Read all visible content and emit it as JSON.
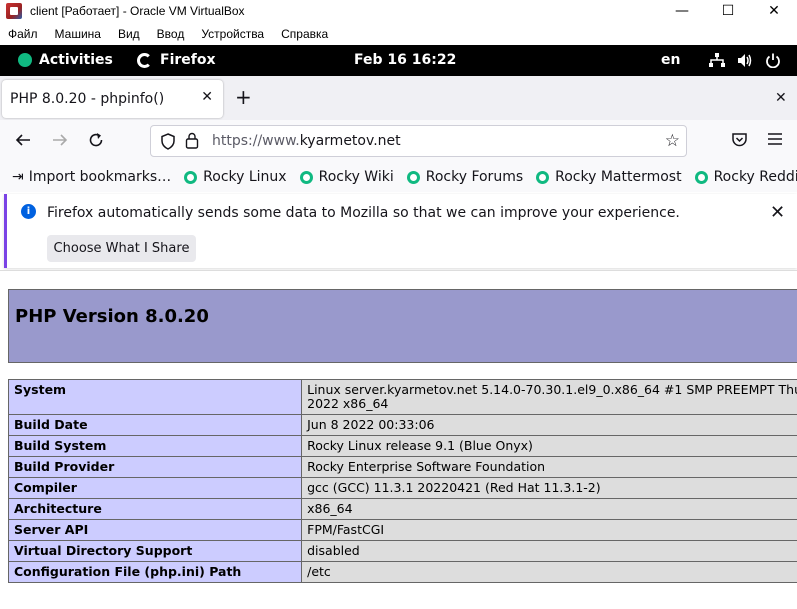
{
  "window": {
    "title": "client [Работает] - Oracle VM VirtualBox",
    "controls": {
      "minimize": "—",
      "maximize": "☐",
      "close": "✕"
    }
  },
  "vbox_menu": [
    "Файл",
    "Машина",
    "Вид",
    "Ввод",
    "Устройства",
    "Справка"
  ],
  "gnome": {
    "activities": "Activities",
    "app": "Firefox",
    "clock": "Feb 16  16:22",
    "lang": "en",
    "icons": [
      "network-icon",
      "volume-icon",
      "power-icon"
    ]
  },
  "browser": {
    "tab_title": "PHP 8.0.20 - phpinfo()",
    "url_prefix": "https://www.",
    "url_host": "kyarmetov.net",
    "bookmarks": [
      {
        "label": "Import bookmarks…",
        "icon": "import-icon"
      },
      {
        "label": "Rocky Linux",
        "icon": "rocky-icon"
      },
      {
        "label": "Rocky Wiki",
        "icon": "rocky-icon"
      },
      {
        "label": "Rocky Forums",
        "icon": "rocky-icon"
      },
      {
        "label": "Rocky Mattermost",
        "icon": "rocky-icon"
      },
      {
        "label": "Rocky Reddit",
        "icon": "rocky-icon"
      }
    ],
    "notification": {
      "message": "Firefox automatically sends some data to Mozilla so that we can improve your experience.",
      "button": "Choose What I Share"
    }
  },
  "php": {
    "header": "PHP Version 8.0.20",
    "rows": [
      {
        "key": "System",
        "value": "Linux server.kyarmetov.net 5.14.0-70.30.1.el9_0.x86_64 #1 SMP PREEMPT Thu",
        "value2": "2022 x86_64"
      },
      {
        "key": "Build Date",
        "value": "Jun 8 2022 00:33:06"
      },
      {
        "key": "Build System",
        "value": "Rocky Linux release 9.1 (Blue Onyx)"
      },
      {
        "key": "Build Provider",
        "value": "Rocky Enterprise Software Foundation"
      },
      {
        "key": "Compiler",
        "value": "gcc (GCC) 11.3.1 20220421 (Red Hat 11.3.1-2)"
      },
      {
        "key": "Architecture",
        "value": "x86_64"
      },
      {
        "key": "Server API",
        "value": "FPM/FastCGI"
      },
      {
        "key": "Virtual Directory Support",
        "value": "disabled"
      },
      {
        "key": "Configuration File (php.ini) Path",
        "value": "/etc"
      }
    ]
  },
  "colors": {
    "php_header": "#9999cc",
    "php_key_cell": "#ccccff",
    "php_value_cell": "#dddddd",
    "rocky_green": "#10b981",
    "info_blue": "#0061e0"
  }
}
